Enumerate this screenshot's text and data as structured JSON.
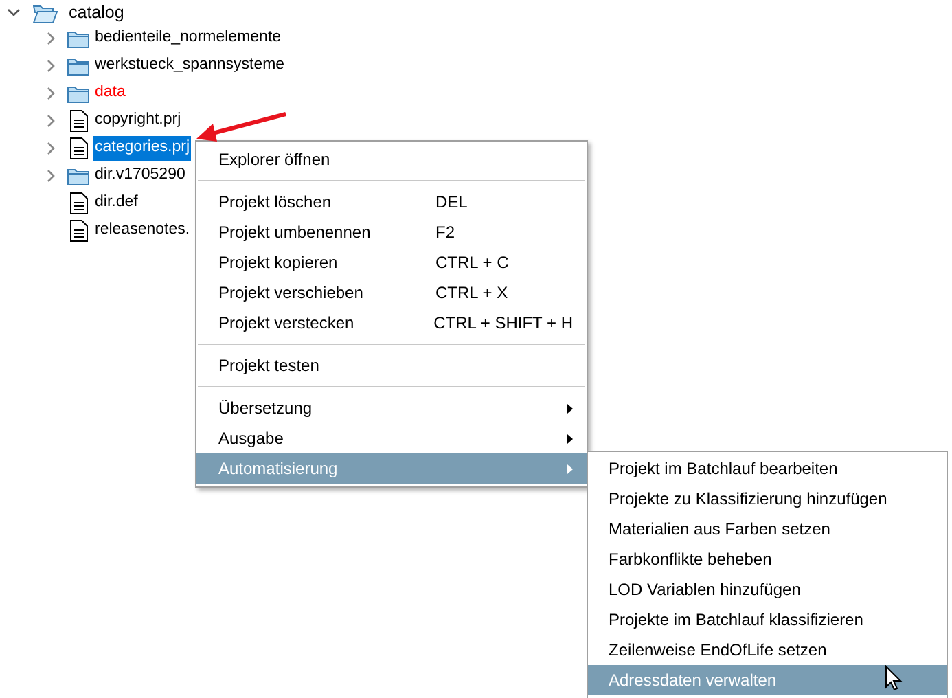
{
  "tree": {
    "root": {
      "label": "catalog",
      "expanded": true,
      "children": [
        {
          "label": "bedienteile_normelemente",
          "kind": "folder",
          "expandable": true,
          "selected": false,
          "color": "#000000"
        },
        {
          "label": "werkstueck_spannsysteme",
          "kind": "folder",
          "expandable": true,
          "selected": false,
          "color": "#000000"
        },
        {
          "label": "data",
          "kind": "folder",
          "expandable": true,
          "selected": false,
          "color": "#ff0000"
        },
        {
          "label": "copyright.prj",
          "kind": "file",
          "expandable": true,
          "selected": false,
          "color": "#000000"
        },
        {
          "label": "categories.prj",
          "kind": "file",
          "expandable": true,
          "selected": true
        },
        {
          "label": "dir.v1705290",
          "kind": "folder",
          "expandable": true,
          "selected": false,
          "color": "#000000"
        },
        {
          "label": "dir.def",
          "kind": "file",
          "expandable": false,
          "selected": false,
          "color": "#000000"
        },
        {
          "label": "releasenotes.",
          "kind": "file",
          "expandable": false,
          "selected": false,
          "color": "#000000"
        }
      ]
    }
  },
  "context_menu": [
    {
      "kind": "item",
      "label": "Explorer öffnen",
      "submenu": false,
      "selected": false
    },
    {
      "kind": "separator"
    },
    {
      "kind": "item",
      "label": "Projekt löschen",
      "shortcut": "DEL",
      "submenu": false,
      "selected": false
    },
    {
      "kind": "item",
      "label": "Projekt umbenennen",
      "shortcut": "F2",
      "submenu": false,
      "selected": false
    },
    {
      "kind": "item",
      "label": "Projekt kopieren",
      "shortcut": "CTRL + C",
      "submenu": false,
      "selected": false
    },
    {
      "kind": "item",
      "label": "Projekt verschieben",
      "shortcut": "CTRL + X",
      "submenu": false,
      "selected": false
    },
    {
      "kind": "item",
      "label": "Projekt verstecken",
      "shortcut": "CTRL + SHIFT + H",
      "submenu": false,
      "selected": false
    },
    {
      "kind": "separator"
    },
    {
      "kind": "item",
      "label": "Projekt testen",
      "submenu": false,
      "selected": false
    },
    {
      "kind": "separator"
    },
    {
      "kind": "item",
      "label": "Übersetzung",
      "submenu": true,
      "selected": false
    },
    {
      "kind": "item",
      "label": "Ausgabe",
      "submenu": true,
      "selected": false
    },
    {
      "kind": "item",
      "label": "Automatisierung",
      "submenu": true,
      "selected": true
    }
  ],
  "submenu": [
    {
      "label": "Projekt im Batchlauf bearbeiten",
      "selected": false
    },
    {
      "label": "Projekte zu Klassifizierung hinzufügen",
      "selected": false
    },
    {
      "label": "Materialien aus Farben setzen",
      "selected": false
    },
    {
      "label": "Farbkonflikte beheben",
      "selected": false
    },
    {
      "label": "LOD Variablen hinzufügen",
      "selected": false
    },
    {
      "label": "Projekte im Batchlauf klassifizieren",
      "selected": false
    },
    {
      "label": "Zeilenweise EndOfLife setzen",
      "selected": false
    },
    {
      "label": "Adressdaten verwalten",
      "selected": true
    }
  ]
}
